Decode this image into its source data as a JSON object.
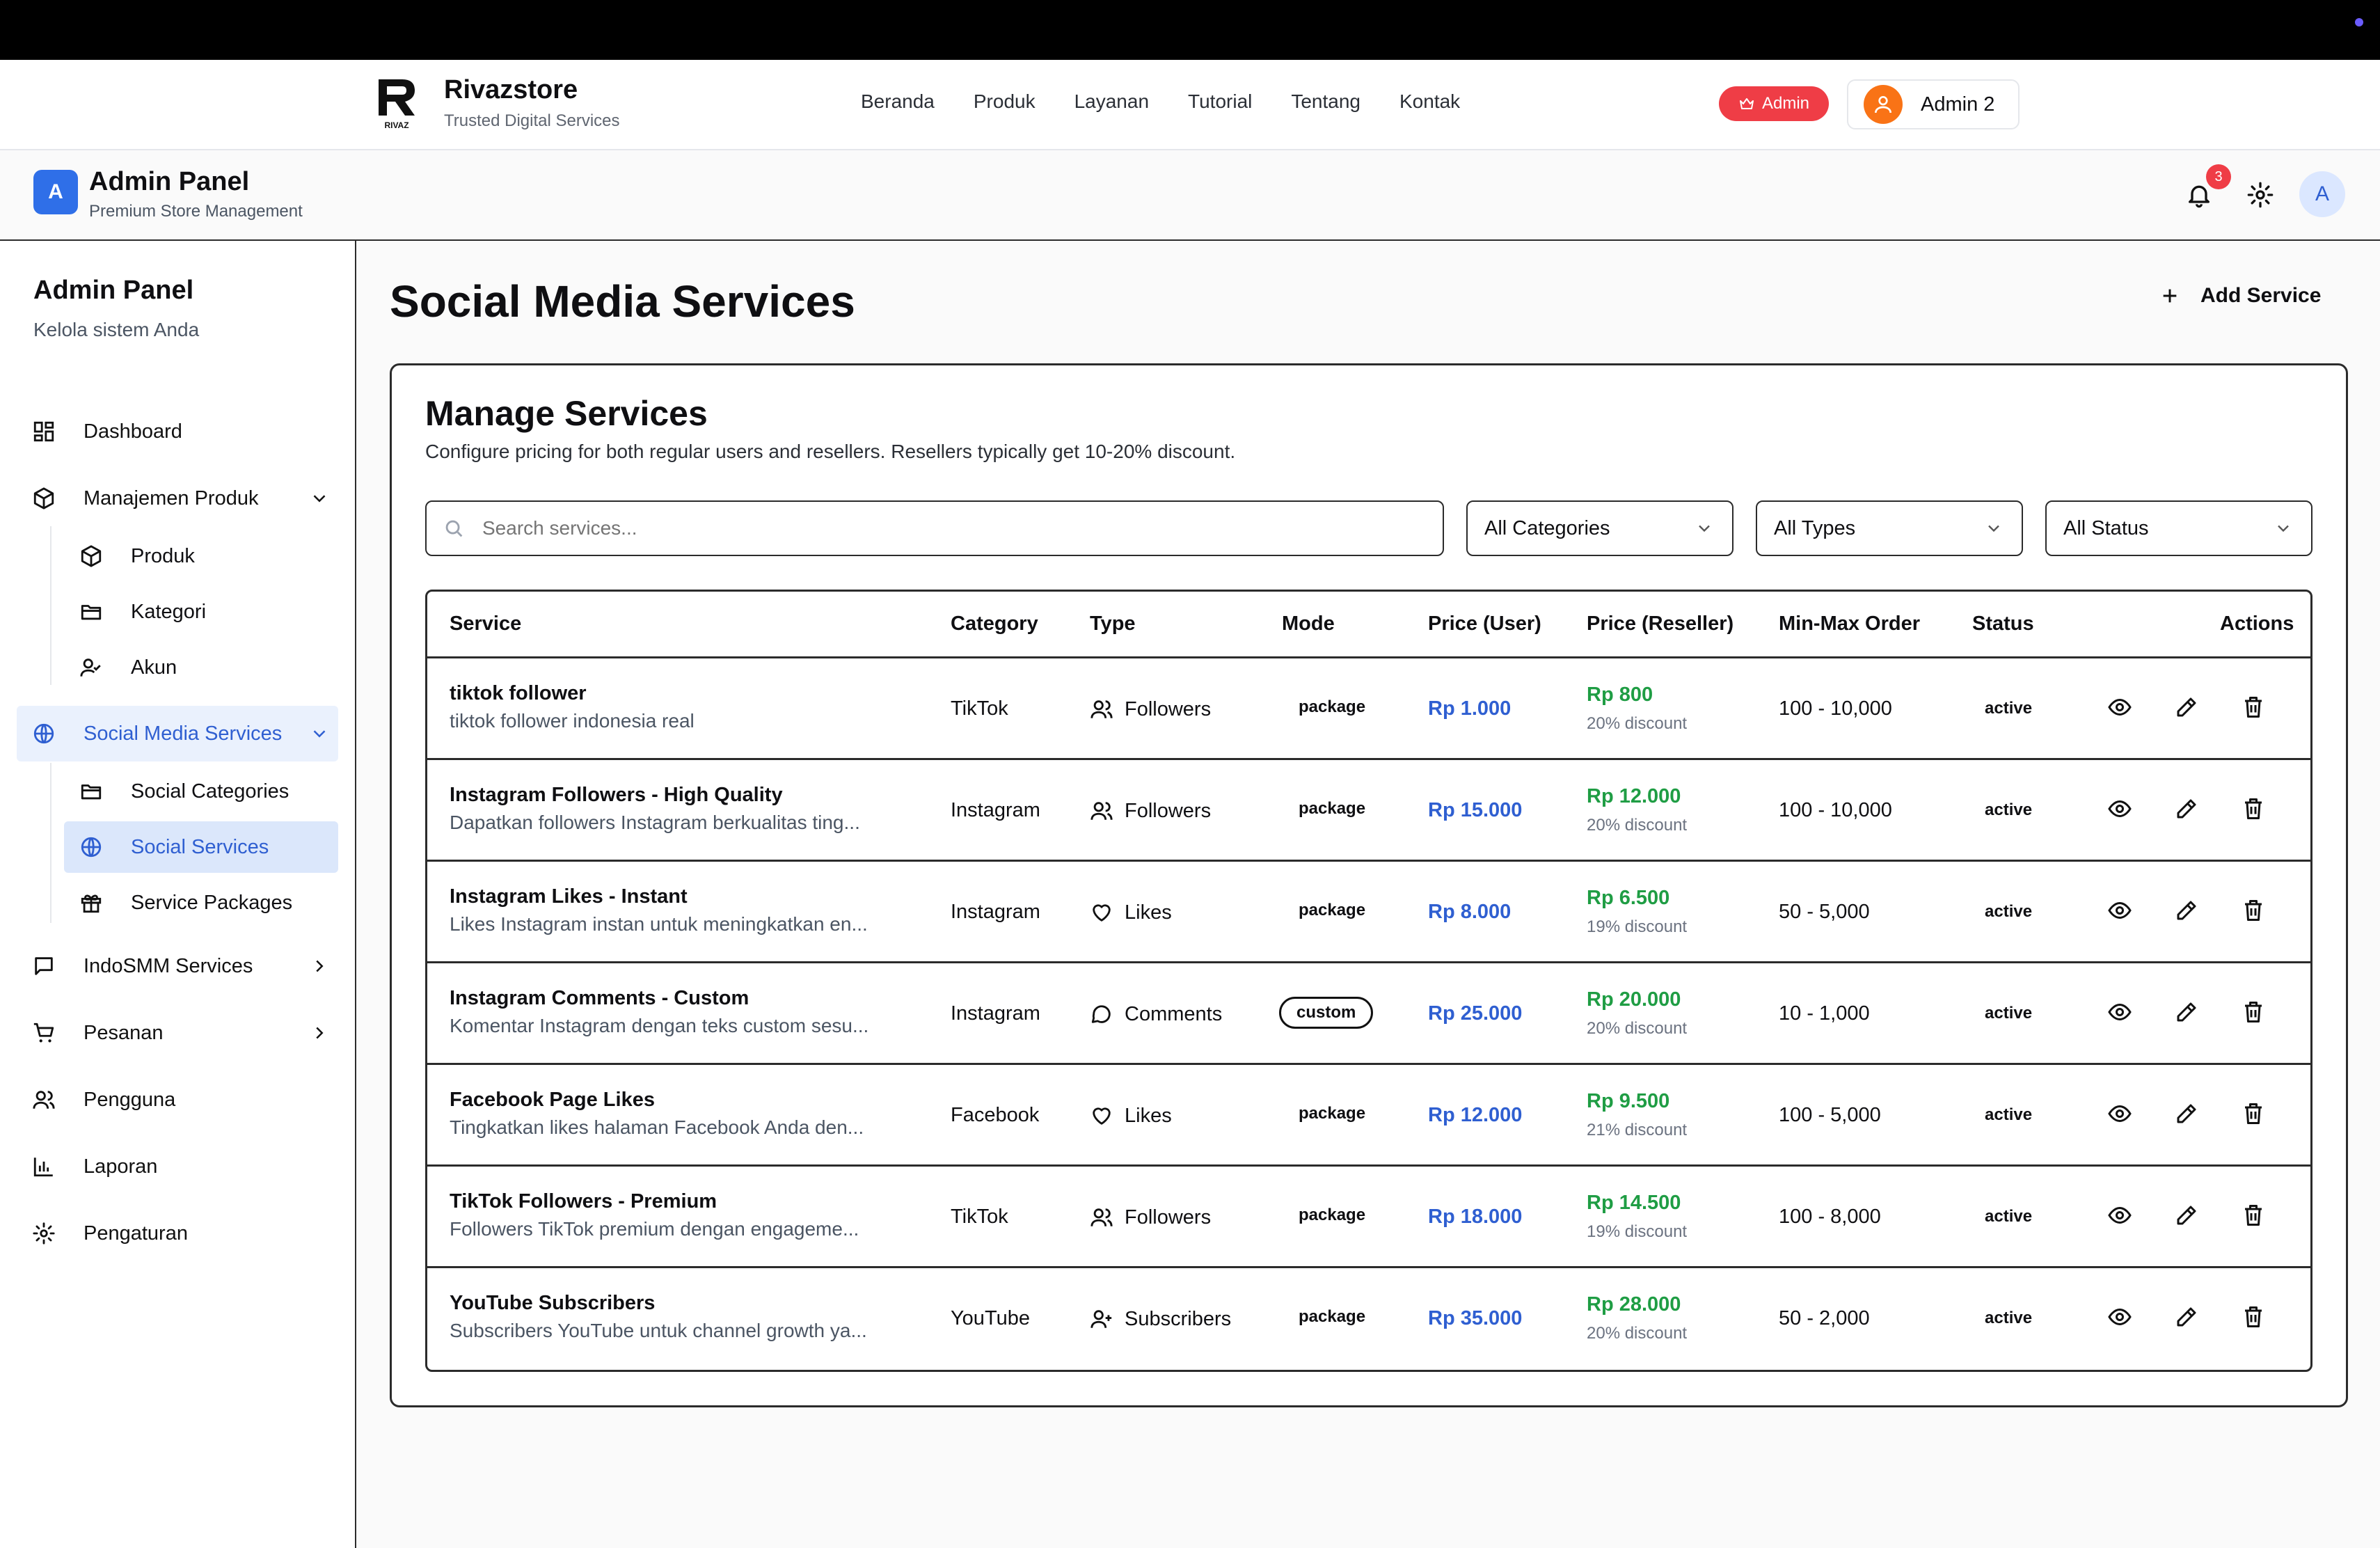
{
  "site": {
    "brand_name": "Rivazstore",
    "brand_sub": "Trusted Digital Services",
    "logo_text": "RIVAZ",
    "nav": [
      "Beranda",
      "Produk",
      "Layanan",
      "Tutorial",
      "Tentang",
      "Kontak"
    ],
    "admin_badge": "Admin",
    "user_name": "Admin 2"
  },
  "panel": {
    "title": "Admin Panel",
    "subtitle": "Premium Store Management",
    "logo_letter": "A",
    "notif_count": "3",
    "avatar_letter": "A"
  },
  "sidebar": {
    "title": "Admin Panel",
    "subtitle": "Kelola sistem Anda",
    "items": {
      "dashboard": "Dashboard",
      "manajemen_produk": "Manajemen Produk",
      "produk": "Produk",
      "kategori": "Kategori",
      "akun": "Akun",
      "social_media_services": "Social Media Services",
      "social_categories": "Social Categories",
      "social_services": "Social Services",
      "service_packages": "Service Packages",
      "indosmm": "IndoSMM Services",
      "pesanan": "Pesanan",
      "pengguna": "Pengguna",
      "laporan": "Laporan",
      "pengaturan": "Pengaturan"
    }
  },
  "page": {
    "title": "Social Media Services",
    "add_label": "Add Service"
  },
  "card": {
    "title": "Manage Services",
    "subtitle": "Configure pricing for both regular users and resellers. Resellers typically get 10-20% discount.",
    "search_placeholder": "Search services...",
    "filters": [
      "All Categories",
      "All Types",
      "All Status"
    ]
  },
  "table": {
    "headers": [
      "Service",
      "Category",
      "Type",
      "Mode",
      "Price (User)",
      "Price (Reseller)",
      "Min-Max Order",
      "Status",
      "Actions"
    ],
    "rows": [
      {
        "name": "tiktok follower",
        "desc": "tiktok follower indonesia real",
        "category": "TikTok",
        "type": "Followers",
        "type_icon": "users-icon",
        "mode": "package",
        "price_user": "Rp 1.000",
        "price_reseller": "Rp 800",
        "discount": "20% discount",
        "minmax": "100 - 10,000",
        "status": "active"
      },
      {
        "name": "Instagram Followers - High Quality",
        "desc": "Dapatkan followers Instagram berkualitas ting...",
        "category": "Instagram",
        "type": "Followers",
        "type_icon": "users-icon",
        "mode": "package",
        "price_user": "Rp 15.000",
        "price_reseller": "Rp 12.000",
        "discount": "20% discount",
        "minmax": "100 - 10,000",
        "status": "active"
      },
      {
        "name": "Instagram Likes - Instant",
        "desc": "Likes Instagram instan untuk meningkatkan en...",
        "category": "Instagram",
        "type": "Likes",
        "type_icon": "heart-icon",
        "mode": "package",
        "price_user": "Rp 8.000",
        "price_reseller": "Rp 6.500",
        "discount": "19% discount",
        "minmax": "50 - 5,000",
        "status": "active"
      },
      {
        "name": "Instagram Comments - Custom",
        "desc": "Komentar Instagram dengan teks custom sesu...",
        "category": "Instagram",
        "type": "Comments",
        "type_icon": "comment-icon",
        "mode": "custom",
        "price_user": "Rp 25.000",
        "price_reseller": "Rp 20.000",
        "discount": "20% discount",
        "minmax": "10 - 1,000",
        "status": "active"
      },
      {
        "name": "Facebook Page Likes",
        "desc": "Tingkatkan likes halaman Facebook Anda den...",
        "category": "Facebook",
        "type": "Likes",
        "type_icon": "heart-icon",
        "mode": "package",
        "price_user": "Rp 12.000",
        "price_reseller": "Rp 9.500",
        "discount": "21% discount",
        "minmax": "100 - 5,000",
        "status": "active"
      },
      {
        "name": "TikTok Followers - Premium",
        "desc": "Followers TikTok premium dengan engageme...",
        "category": "TikTok",
        "type": "Followers",
        "type_icon": "users-icon",
        "mode": "package",
        "price_user": "Rp 18.000",
        "price_reseller": "Rp 14.500",
        "discount": "19% discount",
        "minmax": "100 - 8,000",
        "status": "active"
      },
      {
        "name": "YouTube Subscribers",
        "desc": "Subscribers YouTube untuk channel growth ya...",
        "category": "YouTube",
        "type": "Subscribers",
        "type_icon": "user-plus-icon",
        "mode": "package",
        "price_user": "Rp 35.000",
        "price_reseller": "Rp 28.000",
        "discount": "20% discount",
        "minmax": "50 - 2,000",
        "status": "active"
      }
    ]
  },
  "colors": {
    "accent_blue": "#2f5fd1",
    "price_green": "#1f9d44",
    "badge_red": "#ef3d46",
    "avatar_orange": "#f97316"
  }
}
